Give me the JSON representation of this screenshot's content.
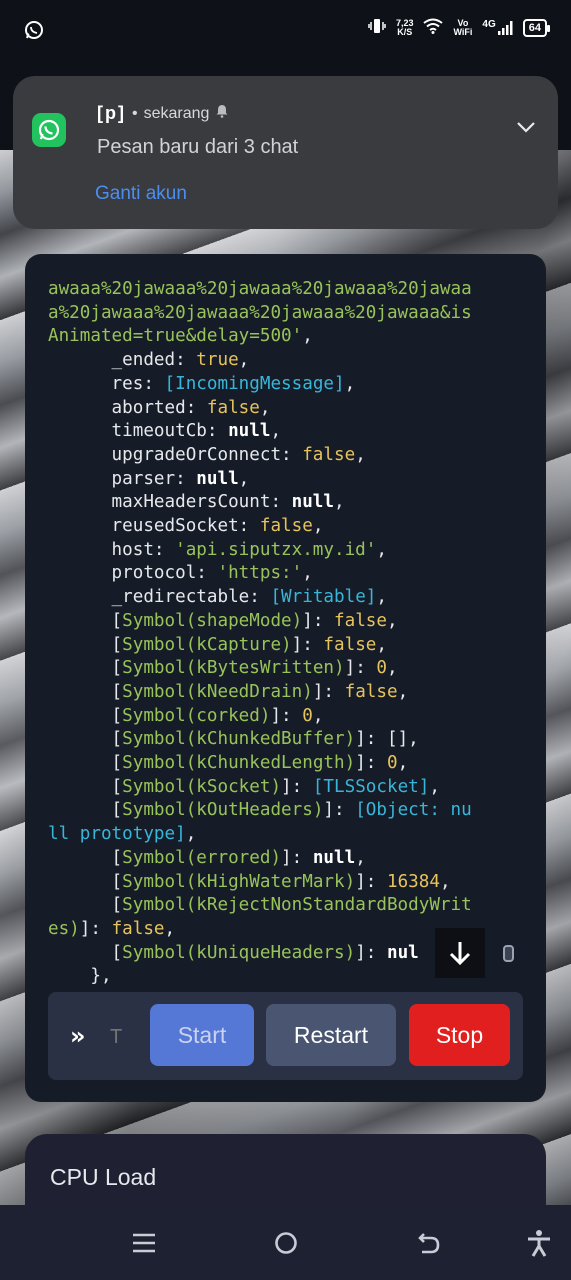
{
  "status_bar": {
    "net_speed_value": "7,23",
    "net_speed_unit": "K/S",
    "vowifi_top": "Vo",
    "vowifi_bottom": "WiFi",
    "signal_label": "4G",
    "battery": "64"
  },
  "notification": {
    "app_name": "[p]",
    "time": "sekarang",
    "message": "Pesan baru dari 3 chat",
    "action": "Ganti akun"
  },
  "console": {
    "lines": [
      {
        "segments": [
          {
            "t": "awaaa%20jawaaa%20jawaaa%20jawaaa%20jawaa",
            "c": "s"
          }
        ]
      },
      {
        "segments": [
          {
            "t": "a%20jawaaa%20jawaaa%20jawaaa%20jawaaa&is",
            "c": "s"
          }
        ]
      },
      {
        "segments": [
          {
            "t": "Animated=true&delay=500'",
            "c": "s"
          },
          {
            "t": ",",
            "c": "k"
          }
        ]
      },
      {
        "segments": [
          {
            "t": "      _ended: ",
            "c": "k"
          },
          {
            "t": "true",
            "c": "b"
          },
          {
            "t": ",",
            "c": "k"
          }
        ]
      },
      {
        "segments": [
          {
            "t": "      res: ",
            "c": "k"
          },
          {
            "t": "[IncomingMessage]",
            "c": "l"
          },
          {
            "t": ",",
            "c": "k"
          }
        ]
      },
      {
        "segments": [
          {
            "t": "      aborted: ",
            "c": "k"
          },
          {
            "t": "false",
            "c": "b"
          },
          {
            "t": ",",
            "c": "k"
          }
        ]
      },
      {
        "segments": [
          {
            "t": "      timeoutCb: ",
            "c": "k"
          },
          {
            "t": "null",
            "c": "n"
          },
          {
            "t": ",",
            "c": "k"
          }
        ]
      },
      {
        "segments": [
          {
            "t": "      upgradeOrConnect: ",
            "c": "k"
          },
          {
            "t": "false",
            "c": "b"
          },
          {
            "t": ",",
            "c": "k"
          }
        ]
      },
      {
        "segments": [
          {
            "t": "      parser: ",
            "c": "k"
          },
          {
            "t": "null",
            "c": "n"
          },
          {
            "t": ",",
            "c": "k"
          }
        ]
      },
      {
        "segments": [
          {
            "t": "      maxHeadersCount: ",
            "c": "k"
          },
          {
            "t": "null",
            "c": "n"
          },
          {
            "t": ",",
            "c": "k"
          }
        ]
      },
      {
        "segments": [
          {
            "t": "      reusedSocket: ",
            "c": "k"
          },
          {
            "t": "false",
            "c": "b"
          },
          {
            "t": ",",
            "c": "k"
          }
        ]
      },
      {
        "segments": [
          {
            "t": "      host: ",
            "c": "k"
          },
          {
            "t": "'api.siputzx.my.id'",
            "c": "s"
          },
          {
            "t": ",",
            "c": "k"
          }
        ]
      },
      {
        "segments": [
          {
            "t": "      protocol: ",
            "c": "k"
          },
          {
            "t": "'https:'",
            "c": "s"
          },
          {
            "t": ",",
            "c": "k"
          }
        ]
      },
      {
        "segments": [
          {
            "t": "      _redirectable: ",
            "c": "k"
          },
          {
            "t": "[Writable]",
            "c": "l"
          },
          {
            "t": ",",
            "c": "k"
          }
        ]
      },
      {
        "segments": [
          {
            "t": "      [",
            "c": "k"
          },
          {
            "t": "Symbol(shapeMode)",
            "c": "y"
          },
          {
            "t": "]: ",
            "c": "k"
          },
          {
            "t": "false",
            "c": "b"
          },
          {
            "t": ",",
            "c": "k"
          }
        ]
      },
      {
        "segments": [
          {
            "t": "      [",
            "c": "k"
          },
          {
            "t": "Symbol(kCapture)",
            "c": "y"
          },
          {
            "t": "]: ",
            "c": "k"
          },
          {
            "t": "false",
            "c": "b"
          },
          {
            "t": ",",
            "c": "k"
          }
        ]
      },
      {
        "segments": [
          {
            "t": "      [",
            "c": "k"
          },
          {
            "t": "Symbol(kBytesWritten)",
            "c": "y"
          },
          {
            "t": "]: ",
            "c": "k"
          },
          {
            "t": "0",
            "c": "b"
          },
          {
            "t": ",",
            "c": "k"
          }
        ]
      },
      {
        "segments": [
          {
            "t": "      [",
            "c": "k"
          },
          {
            "t": "Symbol(kNeedDrain)",
            "c": "y"
          },
          {
            "t": "]: ",
            "c": "k"
          },
          {
            "t": "false",
            "c": "b"
          },
          {
            "t": ",",
            "c": "k"
          }
        ]
      },
      {
        "segments": [
          {
            "t": "      [",
            "c": "k"
          },
          {
            "t": "Symbol(corked)",
            "c": "y"
          },
          {
            "t": "]: ",
            "c": "k"
          },
          {
            "t": "0",
            "c": "b"
          },
          {
            "t": ",",
            "c": "k"
          }
        ]
      },
      {
        "segments": [
          {
            "t": "      [",
            "c": "k"
          },
          {
            "t": "Symbol(kChunkedBuffer)",
            "c": "y"
          },
          {
            "t": "]: [],",
            "c": "k"
          }
        ]
      },
      {
        "segments": [
          {
            "t": "      [",
            "c": "k"
          },
          {
            "t": "Symbol(kChunkedLength)",
            "c": "y"
          },
          {
            "t": "]: ",
            "c": "k"
          },
          {
            "t": "0",
            "c": "b"
          },
          {
            "t": ",",
            "c": "k"
          }
        ]
      },
      {
        "segments": [
          {
            "t": "      [",
            "c": "k"
          },
          {
            "t": "Symbol(kSocket)",
            "c": "y"
          },
          {
            "t": "]: ",
            "c": "k"
          },
          {
            "t": "[TLSSocket]",
            "c": "l"
          },
          {
            "t": ",",
            "c": "k"
          }
        ]
      },
      {
        "segments": [
          {
            "t": "      [",
            "c": "k"
          },
          {
            "t": "Symbol(kOutHeaders)",
            "c": "y"
          },
          {
            "t": "]: ",
            "c": "k"
          },
          {
            "t": "[Object: nu",
            "c": "l"
          }
        ]
      },
      {
        "segments": [
          {
            "t": "ll prototype]",
            "c": "l"
          },
          {
            "t": ",",
            "c": "k"
          }
        ]
      },
      {
        "segments": [
          {
            "t": "      [",
            "c": "k"
          },
          {
            "t": "Symbol(errored)",
            "c": "y"
          },
          {
            "t": "]: ",
            "c": "k"
          },
          {
            "t": "null",
            "c": "n"
          },
          {
            "t": ",",
            "c": "k"
          }
        ]
      },
      {
        "segments": [
          {
            "t": "      [",
            "c": "k"
          },
          {
            "t": "Symbol(kHighWaterMark)",
            "c": "y"
          },
          {
            "t": "]: ",
            "c": "k"
          },
          {
            "t": "16384",
            "c": "b"
          },
          {
            "t": ",",
            "c": "k"
          }
        ]
      },
      {
        "segments": [
          {
            "t": "      [",
            "c": "k"
          },
          {
            "t": "Symbol(kRejectNonStandardBodyWrit",
            "c": "y"
          }
        ]
      },
      {
        "segments": [
          {
            "t": "es)",
            "c": "y"
          },
          {
            "t": "]: ",
            "c": "k"
          },
          {
            "t": "false",
            "c": "b"
          },
          {
            "t": ",",
            "c": "k"
          }
        ]
      },
      {
        "segments": [
          {
            "t": "      [",
            "c": "k"
          },
          {
            "t": "Symbol(kUniqueHeaders)",
            "c": "y"
          },
          {
            "t": "]: ",
            "c": "k"
          },
          {
            "t": "nul",
            "c": "n"
          }
        ]
      },
      {
        "segments": [
          {
            "t": "    },",
            "c": "k"
          }
        ]
      }
    ]
  },
  "controls": {
    "prompt_symbol": "»",
    "input_placeholder": "T",
    "start_label": "Start",
    "restart_label": "Restart",
    "stop_label": "Stop"
  },
  "cpu_card": {
    "title": "CPU Load"
  }
}
